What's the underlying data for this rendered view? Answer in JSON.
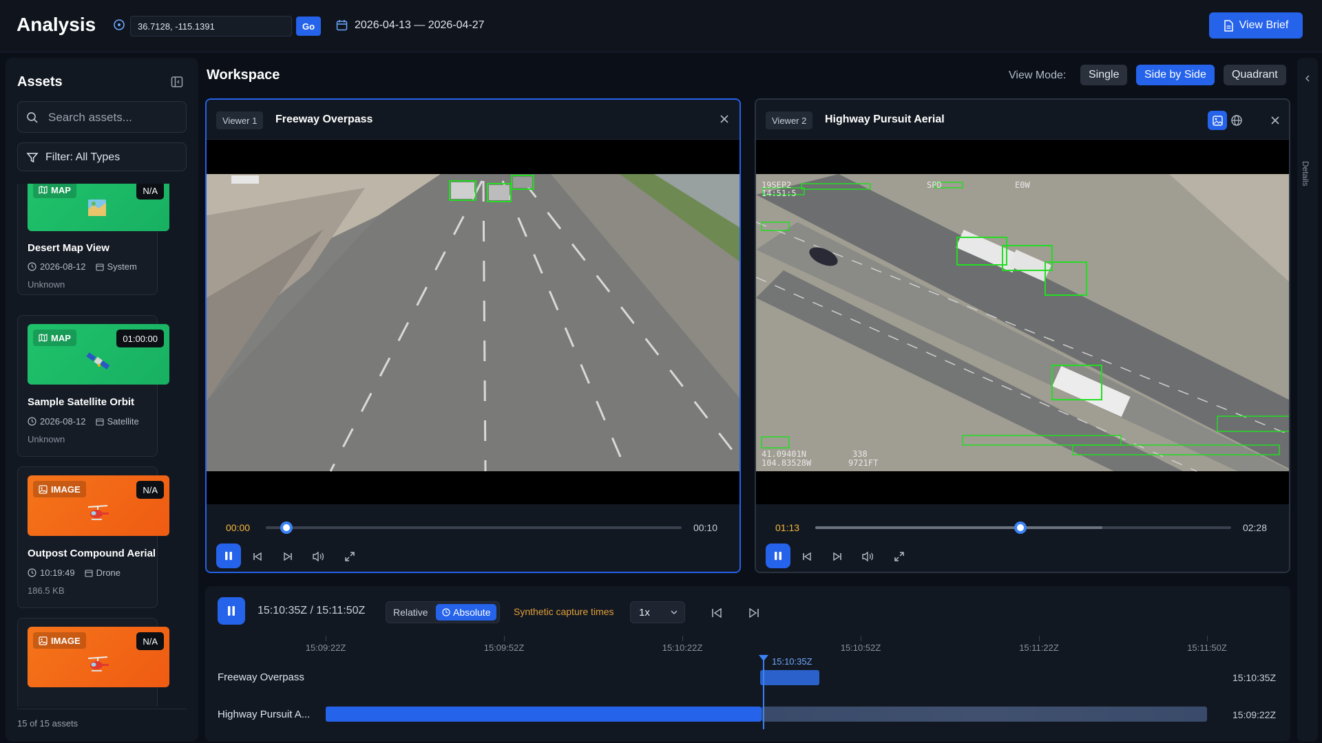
{
  "header": {
    "title": "Analysis",
    "coords_value": "36.7128, -115.1391",
    "go_label": "Go",
    "date_range": "2026-04-13 — 2026-04-27",
    "view_brief_label": "View Brief"
  },
  "sidebar": {
    "title": "Assets",
    "search_placeholder": "Search assets...",
    "filter_label": "Filter: All Types",
    "footer": "15 of 15 assets",
    "cards": [
      {
        "type": "MAP",
        "duration": "N/A",
        "title": "Desert Map View",
        "date": "2026-08-12",
        "source": "System",
        "sub": "Unknown",
        "color": "green"
      },
      {
        "type": "MAP",
        "duration": "01:00:00",
        "title": "Sample Satellite Orbit",
        "date": "2026-08-12",
        "source": "Satellite",
        "sub": "Unknown",
        "color": "green"
      },
      {
        "type": "IMAGE",
        "duration": "N/A",
        "title": "Outpost Compound Aerial",
        "date": "10:19:49",
        "source": "Drone",
        "sub": "186.5 KB",
        "color": "orange"
      },
      {
        "type": "IMAGE",
        "duration": "N/A",
        "title": "",
        "date": "",
        "source": "",
        "sub": "",
        "color": "orange"
      }
    ]
  },
  "workspace": {
    "title": "Workspace",
    "view_mode_label": "View Mode:",
    "modes": [
      "Single",
      "Side by Side",
      "Quadrant"
    ],
    "active_mode": "Side by Side"
  },
  "viewers": [
    {
      "badge": "Viewer 1",
      "name": "Freeway Overpass",
      "current": "00:00",
      "end": "00:10",
      "progress": 0.05,
      "buffered": 0.0
    },
    {
      "badge": "Viewer 2",
      "name": "Highway Pursuit Aerial",
      "current": "01:13",
      "end": "02:28",
      "progress": 0.494,
      "buffered": 0.69
    }
  ],
  "timeline": {
    "time_display": "15:10:35Z / 15:11:50Z",
    "relative_label": "Relative",
    "absolute_label": "Absolute",
    "synthetic_label": "Synthetic capture times",
    "speed": "1x",
    "ticks": [
      "15:09:22Z",
      "15:09:52Z",
      "15:10:22Z",
      "15:10:52Z",
      "15:11:22Z",
      "15:11:50Z"
    ],
    "playhead_label": "15:10:35Z",
    "rows": [
      {
        "label": "Freeway Overpass",
        "end": "15:10:35Z"
      },
      {
        "label": "Highway Pursuit A...",
        "end": "15:09:22Z"
      }
    ]
  },
  "right_panel": {
    "label": "Details"
  },
  "video_overlay_v2": {
    "hud_top": "19SEP2",
    "hud_time": "14:51:5",
    "hud_coord1": "41.09401N",
    "hud_coord2": "104.83528W",
    "hud_alt": "338",
    "hud_ft": "9721FT",
    "hud_spd": "SPD",
    "hud_e": "E0W"
  },
  "colors": {
    "accent": "#2563eb",
    "amber": "#f5b83d",
    "map": "#1fc26b",
    "image": "#f5741a"
  }
}
